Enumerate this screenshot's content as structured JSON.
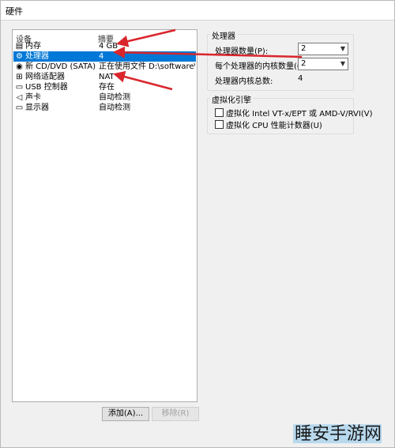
{
  "window": {
    "title": "硬件"
  },
  "device_list": {
    "col_device": "设备",
    "col_summary": "摘要",
    "rows": [
      {
        "icon": "memory-icon",
        "device": "内存",
        "summary": "4 GB",
        "selected": false
      },
      {
        "icon": "processor-icon",
        "device": "处理器",
        "summary": "4",
        "selected": true
      },
      {
        "icon": "cd-dvd-icon",
        "device": "新 CD/DVD (SATA)",
        "summary": "正在使用文件 D:\\software\\VM...",
        "selected": false
      },
      {
        "icon": "network-adapter-icon",
        "device": "网络适配器",
        "summary": "NAT",
        "selected": false
      },
      {
        "icon": "usb-controller-icon",
        "device": "USB 控制器",
        "summary": "存在",
        "selected": false
      },
      {
        "icon": "sound-card-icon",
        "device": "声卡",
        "summary": "自动检测",
        "selected": false
      },
      {
        "icon": "display-icon",
        "device": "显示器",
        "summary": "自动检测",
        "selected": false
      }
    ],
    "add_button": "添加(A)...",
    "remove_button": "移除(R)"
  },
  "processors": {
    "group_title": "处理器",
    "count_label": "处理器数量(P):",
    "count_value": "2",
    "cores_label": "每个处理器的内核数量(C):",
    "cores_value": "2",
    "total_label": "处理器内核总数:",
    "total_value": "4"
  },
  "virtualization": {
    "group_title": "虚拟化引擎",
    "opt_vtx": "虚拟化 Intel VT-x/EPT 或 AMD-V/RVI(V)",
    "opt_vtx_checked": false,
    "opt_counters": "虚拟化 CPU 性能计数器(U)",
    "opt_counters_checked": false
  },
  "overlay": {
    "arrow_color": "#d9262c",
    "watermark": "睡安手游网"
  }
}
